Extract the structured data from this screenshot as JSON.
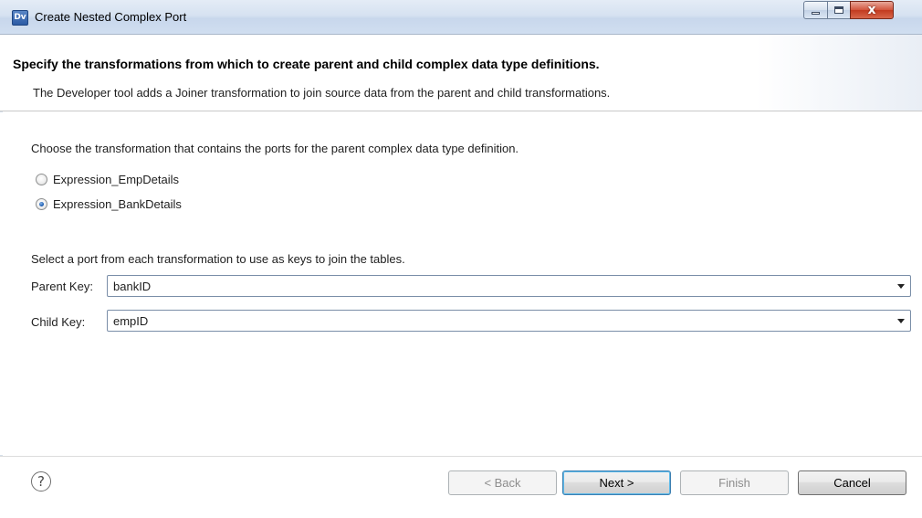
{
  "window": {
    "app_icon_text": "Dv",
    "title": "Create Nested Complex Port"
  },
  "header": {
    "title": "Specify the transformations from which to create parent and child complex data type definitions.",
    "description": "The Developer tool adds a Joiner transformation to join source data from the parent and child transformations."
  },
  "parent_section": {
    "prompt": "Choose the transformation that contains the ports for the parent complex data type definition.",
    "options": [
      {
        "label": "Expression_EmpDetails",
        "selected": false
      },
      {
        "label": "Expression_BankDetails",
        "selected": true
      }
    ]
  },
  "keys_section": {
    "prompt": "Select a port from each transformation to use as keys to join the tables.",
    "parent_key_label": "Parent Key:",
    "parent_key_value": "bankID",
    "child_key_label": "Child Key:",
    "child_key_value": "empID"
  },
  "footer": {
    "help_glyph": "?",
    "back_label": "< Back",
    "next_label": "Next >",
    "finish_label": "Finish",
    "cancel_label": "Cancel"
  },
  "icons": [
    "app-icon",
    "minimize-icon",
    "maximize-icon",
    "close-icon",
    "help-icon",
    "chevron-down-icon"
  ]
}
